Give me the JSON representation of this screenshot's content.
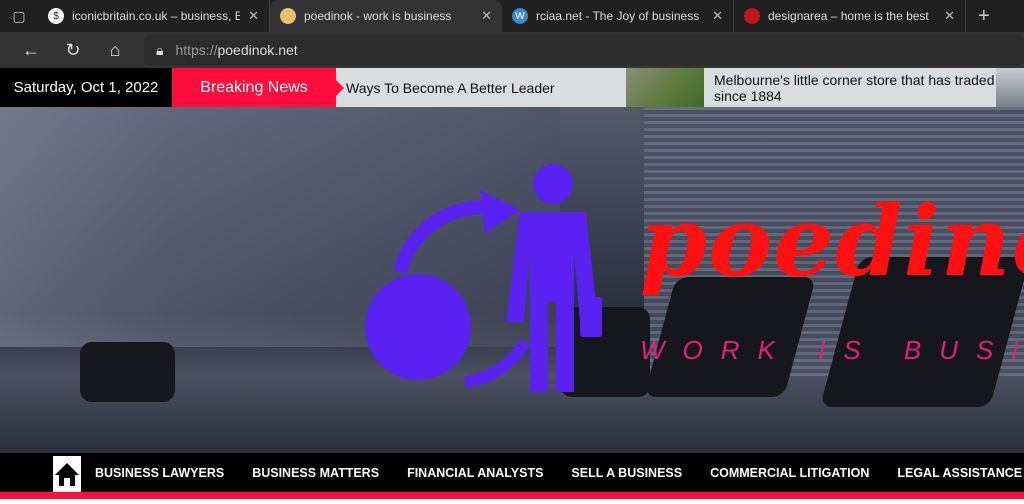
{
  "browser": {
    "tabs": [
      {
        "title": "iconicbritain.co.uk – business, En",
        "favicon": "dollar-icon",
        "active": false
      },
      {
        "title": "poedinok - work is business",
        "favicon": "site-icon",
        "active": true
      },
      {
        "title": "rciaa.net - The Joy of business",
        "favicon": "wordpress-icon",
        "active": false
      },
      {
        "title": "designarea – home is the best",
        "favicon": "designarea-icon",
        "active": false
      }
    ],
    "url_prefix": "https://",
    "url_host": "poedinok.net"
  },
  "ticker": {
    "date": "Saturday, Oct 1, 2022",
    "breaking_label": "Breaking News",
    "headline1": "Ways To Become A Better Leader",
    "headline2": "Melbourne's little corner store that has traded since 1884"
  },
  "hero": {
    "brand": "poedinok",
    "tagline": "WORK IS BUSINESS",
    "logo_color": "#5a22f0",
    "brand_color": "#ff1010",
    "tagline_color": "#e0207a"
  },
  "nav": {
    "items": [
      "BUSINESS LAWYERS",
      "BUSINESS MATTERS",
      "FINANCIAL ANALYSTS",
      "SELL A BUSINESS",
      "COMMERCIAL LITIGATION",
      "LEGAL ASSISTANCE"
    ],
    "accent": "#ff0d3d"
  }
}
